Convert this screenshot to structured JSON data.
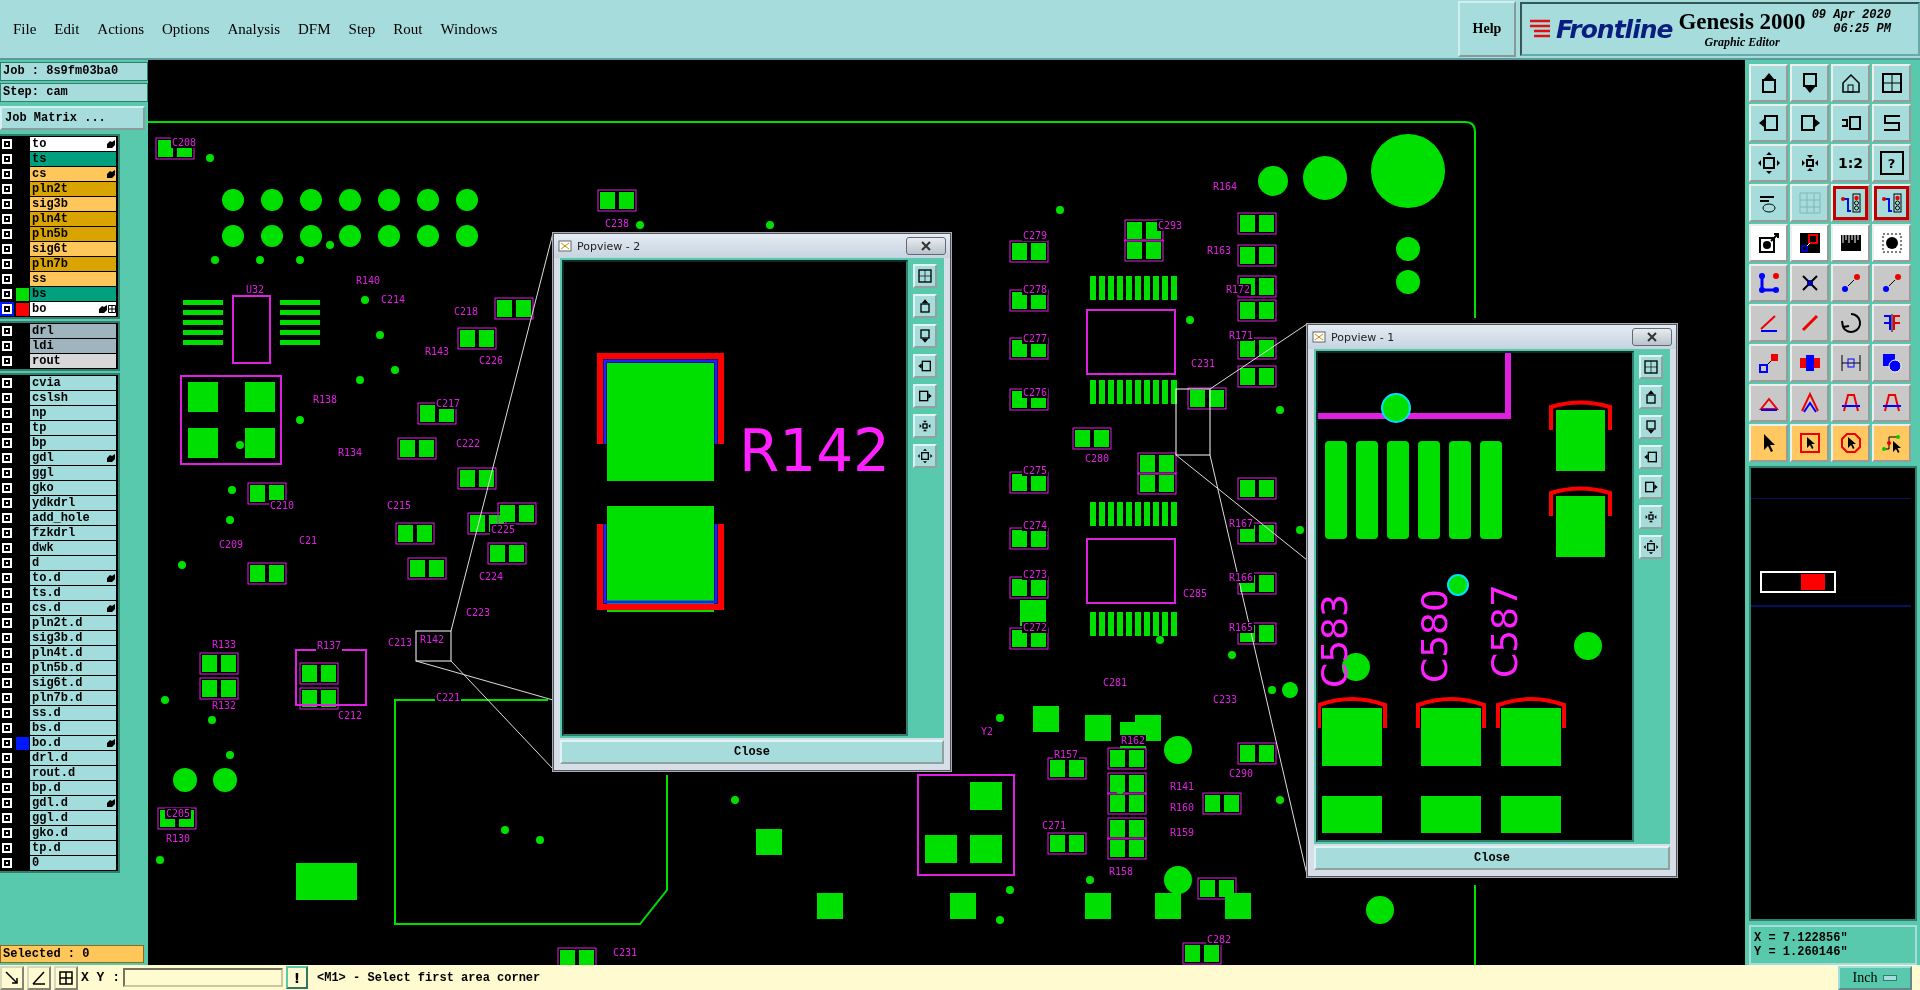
{
  "menu": [
    "File",
    "Edit",
    "Actions",
    "Options",
    "Analysis",
    "DFM",
    "Step",
    "Rout",
    "Windows"
  ],
  "help": "Help",
  "brand": {
    "logo": "Frontline",
    "product": "Genesis 2000",
    "subtitle": "Graphic Editor",
    "date": "09 Apr 2020",
    "time": "06:25 PM"
  },
  "job": {
    "job": "Job : 8s9fm03ba0",
    "step": "Step: cam",
    "matrix_button": "Job Matrix ..."
  },
  "layer_groups": [
    {
      "layers": [
        {
          "name": "to",
          "color": "#ffffff",
          "hand": true,
          "grid_icon": false,
          "selected": false
        },
        {
          "name": "ts",
          "color": "#00a07e",
          "hand": false,
          "grid_icon": false,
          "selected": false
        },
        {
          "name": "cs",
          "color": "#ffc75a",
          "hand": true,
          "grid_icon": false,
          "selected": false
        },
        {
          "name": "pln2t",
          "color": "#d9a400",
          "hand": false,
          "grid_icon": false,
          "selected": false
        },
        {
          "name": "sig3b",
          "color": "#ffc75a",
          "hand": false,
          "grid_icon": false,
          "selected": false
        },
        {
          "name": "pln4t",
          "color": "#d9a400",
          "hand": false,
          "grid_icon": false,
          "selected": false
        },
        {
          "name": "pln5b",
          "color": "#d9a400",
          "hand": false,
          "grid_icon": false,
          "selected": false
        },
        {
          "name": "sig6t",
          "color": "#ffc75a",
          "hand": false,
          "grid_icon": false,
          "selected": false
        },
        {
          "name": "pln7b",
          "color": "#d9a400",
          "hand": false,
          "grid_icon": false,
          "selected": false
        },
        {
          "name": "ss",
          "color": "#ffc75a",
          "hand": false,
          "grid_icon": false,
          "selected": false
        },
        {
          "name": "bs",
          "color": "#00a07e",
          "swatch": {
            "color": "#00e000"
          },
          "hand": false,
          "grid_icon": false,
          "selected": false
        },
        {
          "name": "bo",
          "color": "#ffffff",
          "swatch": {
            "color": "#ff0000"
          },
          "hand": true,
          "grid_icon": true,
          "selected": true
        }
      ]
    },
    {
      "layers": [
        {
          "name": "drl",
          "color": "#9fb4bc",
          "hand": false,
          "grid_icon": false,
          "selected": false
        },
        {
          "name": "ldi",
          "color": "#9fb4bc",
          "hand": false,
          "grid_icon": false,
          "selected": false
        },
        {
          "name": "rout",
          "color": "#d8d8d8",
          "hand": false,
          "grid_icon": false,
          "selected": false
        }
      ]
    },
    {
      "layers": [
        {
          "name": "cvia",
          "color": "#a3dcdc",
          "hand": false,
          "grid_icon": false,
          "selected": false
        },
        {
          "name": "cslsh",
          "color": "#a3dcdc",
          "hand": false,
          "grid_icon": false,
          "selected": false
        },
        {
          "name": "np",
          "color": "#a3dcdc",
          "hand": false,
          "grid_icon": false,
          "selected": false
        },
        {
          "name": "tp",
          "color": "#a3dcdc",
          "hand": false,
          "grid_icon": false,
          "selected": false
        },
        {
          "name": "bp",
          "color": "#a3dcdc",
          "hand": false,
          "grid_icon": false,
          "selected": false
        },
        {
          "name": "gdl",
          "color": "#a3dcdc",
          "hand": true,
          "grid_icon": false,
          "selected": false
        },
        {
          "name": "ggl",
          "color": "#a3dcdc",
          "hand": false,
          "grid_icon": false,
          "selected": false
        },
        {
          "name": "gko",
          "color": "#a3dcdc",
          "hand": false,
          "grid_icon": false,
          "selected": false
        },
        {
          "name": "ydkdrl",
          "color": "#a3dcdc",
          "hand": false,
          "grid_icon": false,
          "selected": false
        },
        {
          "name": "add_hole",
          "color": "#a3dcdc",
          "hand": false,
          "grid_icon": false,
          "selected": false
        },
        {
          "name": "fzkdrl",
          "color": "#a3dcdc",
          "hand": false,
          "grid_icon": false,
          "selected": false
        },
        {
          "name": "dwk",
          "color": "#a3dcdc",
          "hand": false,
          "grid_icon": false,
          "selected": false
        },
        {
          "name": "d",
          "color": "#a3dcdc",
          "hand": false,
          "grid_icon": false,
          "selected": false
        },
        {
          "name": "to.d",
          "color": "#a3dcdc",
          "hand": true,
          "grid_icon": false,
          "selected": false
        },
        {
          "name": "ts.d",
          "color": "#a3dcdc",
          "hand": false,
          "grid_icon": false,
          "selected": false
        },
        {
          "name": "cs.d",
          "color": "#a3dcdc",
          "hand": true,
          "grid_icon": false,
          "selected": false
        },
        {
          "name": "pln2t.d",
          "color": "#a3dcdc",
          "hand": false,
          "grid_icon": false,
          "selected": false
        },
        {
          "name": "sig3b.d",
          "color": "#a3dcdc",
          "hand": false,
          "grid_icon": false,
          "selected": false
        },
        {
          "name": "pln4t.d",
          "color": "#a3dcdc",
          "hand": false,
          "grid_icon": false,
          "selected": false
        },
        {
          "name": "pln5b.d",
          "color": "#a3dcdc",
          "hand": false,
          "grid_icon": false,
          "selected": false
        },
        {
          "name": "sig6t.d",
          "color": "#a3dcdc",
          "hand": false,
          "grid_icon": false,
          "selected": false
        },
        {
          "name": "pln7b.d",
          "color": "#a3dcdc",
          "hand": false,
          "grid_icon": false,
          "selected": false
        },
        {
          "name": "ss.d",
          "color": "#a3dcdc",
          "hand": false,
          "grid_icon": false,
          "selected": false
        },
        {
          "name": "bs.d",
          "color": "#a3dcdc",
          "hand": false,
          "grid_icon": false,
          "selected": false
        },
        {
          "name": "bo.d",
          "color": "#a3dcdc",
          "swatch": {
            "color": "#0018ff"
          },
          "hand": true,
          "grid_icon": false,
          "selected": false
        },
        {
          "name": "drl.d",
          "color": "#a3dcdc",
          "hand": false,
          "grid_icon": false,
          "selected": false
        },
        {
          "name": "rout.d",
          "color": "#a3dcdc",
          "hand": false,
          "grid_icon": false,
          "selected": false
        },
        {
          "name": "bp.d",
          "color": "#a3dcdc",
          "hand": false,
          "grid_icon": false,
          "selected": false
        },
        {
          "name": "gdl.d",
          "color": "#a3dcdc",
          "hand": true,
          "grid_icon": false,
          "selected": false
        },
        {
          "name": "ggl.d",
          "color": "#a3dcdc",
          "hand": false,
          "grid_icon": false,
          "selected": false
        },
        {
          "name": "gko.d",
          "color": "#a3dcdc",
          "hand": false,
          "grid_icon": false,
          "selected": false
        },
        {
          "name": "tp.d",
          "color": "#a3dcdc",
          "hand": false,
          "grid_icon": false,
          "selected": false
        },
        {
          "name": "0",
          "color": "#a3dcdc",
          "hand": false,
          "grid_icon": false,
          "selected": false
        }
      ]
    }
  ],
  "selected_count": "Selected : 0",
  "toolbar": [
    {
      "kind": "view",
      "selected": false
    },
    {
      "kind": "view",
      "selected": false
    },
    {
      "kind": "view",
      "selected": false
    },
    {
      "kind": "view",
      "selected": false
    },
    {
      "kind": "view",
      "selected": false
    },
    {
      "kind": "view",
      "selected": false
    },
    {
      "kind": "view",
      "selected": false
    },
    {
      "kind": "view",
      "selected": false
    },
    {
      "kind": "view",
      "selected": false
    },
    {
      "kind": "view",
      "selected": false
    },
    {
      "kind": "view",
      "label": "1:2",
      "selected": false
    },
    {
      "kind": "view",
      "label": "?",
      "selected": false
    },
    {
      "kind": "view",
      "selected": false
    },
    {
      "kind": "view",
      "selected": false
    },
    {
      "kind": "view",
      "selected": true
    },
    {
      "kind": "view",
      "selected": true
    },
    {
      "kind": "snap",
      "selected": false
    },
    {
      "kind": "snap",
      "selected": false
    },
    {
      "kind": "snap",
      "selected": false
    },
    {
      "kind": "snap",
      "selected": false
    },
    {
      "kind": "edit",
      "selected": false
    },
    {
      "kind": "edit",
      "selected": false
    },
    {
      "kind": "edit",
      "selected": false
    },
    {
      "kind": "edit",
      "selected": false
    },
    {
      "kind": "edit",
      "selected": false
    },
    {
      "kind": "edit",
      "selected": false
    },
    {
      "kind": "edit",
      "selected": false
    },
    {
      "kind": "edit",
      "selected": false
    },
    {
      "kind": "edit",
      "selected": false
    },
    {
      "kind": "edit",
      "selected": false
    },
    {
      "kind": "edit",
      "selected": false
    },
    {
      "kind": "edit",
      "selected": false
    },
    {
      "kind": "edit",
      "selected": false
    },
    {
      "kind": "edit",
      "selected": false
    },
    {
      "kind": "edit",
      "selected": false
    },
    {
      "kind": "edit",
      "selected": false
    },
    {
      "kind": "select",
      "selected": false
    },
    {
      "kind": "select",
      "selected": false
    },
    {
      "kind": "select",
      "selected": false
    },
    {
      "kind": "select",
      "selected": false
    }
  ],
  "canvas_labels": [
    "C208",
    "U32",
    "R140",
    "C214",
    "C218",
    "R143",
    "C226",
    "C217",
    "R138",
    "R134",
    "C222",
    "C210",
    "C209",
    "C21",
    "C215",
    "C225",
    "C224",
    "C223",
    "R133",
    "R132",
    "R137",
    "C212",
    "C213",
    "C221",
    "C205",
    "R130",
    "C238",
    "C279",
    "C278",
    "C277",
    "C276",
    "C275",
    "C274",
    "C273",
    "C272",
    "R164",
    "C293",
    "R163",
    "R172",
    "R171",
    "C231",
    "C280",
    "R167",
    "R166",
    "R165",
    "C285",
    "C281",
    "C233",
    "Y2",
    "R157",
    "R162",
    "R141",
    "R160",
    "R159",
    "R158",
    "C271",
    "C290",
    "C282",
    "C231",
    "R142"
  ],
  "popviews": [
    {
      "title": "Popview - 2",
      "kind": "resistor",
      "labels": [
        "R142"
      ],
      "close": "Close"
    },
    {
      "title": "Popview - 1",
      "kind": "capacitors",
      "labels": [
        "C583",
        "C580",
        "C587"
      ],
      "close": "Close"
    }
  ],
  "coordinates": {
    "x": "X = 7.122856\"",
    "y": "Y = 1.260146\""
  },
  "units": "Inch",
  "status": {
    "xy_label": "X Y :",
    "command": "!",
    "message": "<M1> - Select first area corner"
  }
}
